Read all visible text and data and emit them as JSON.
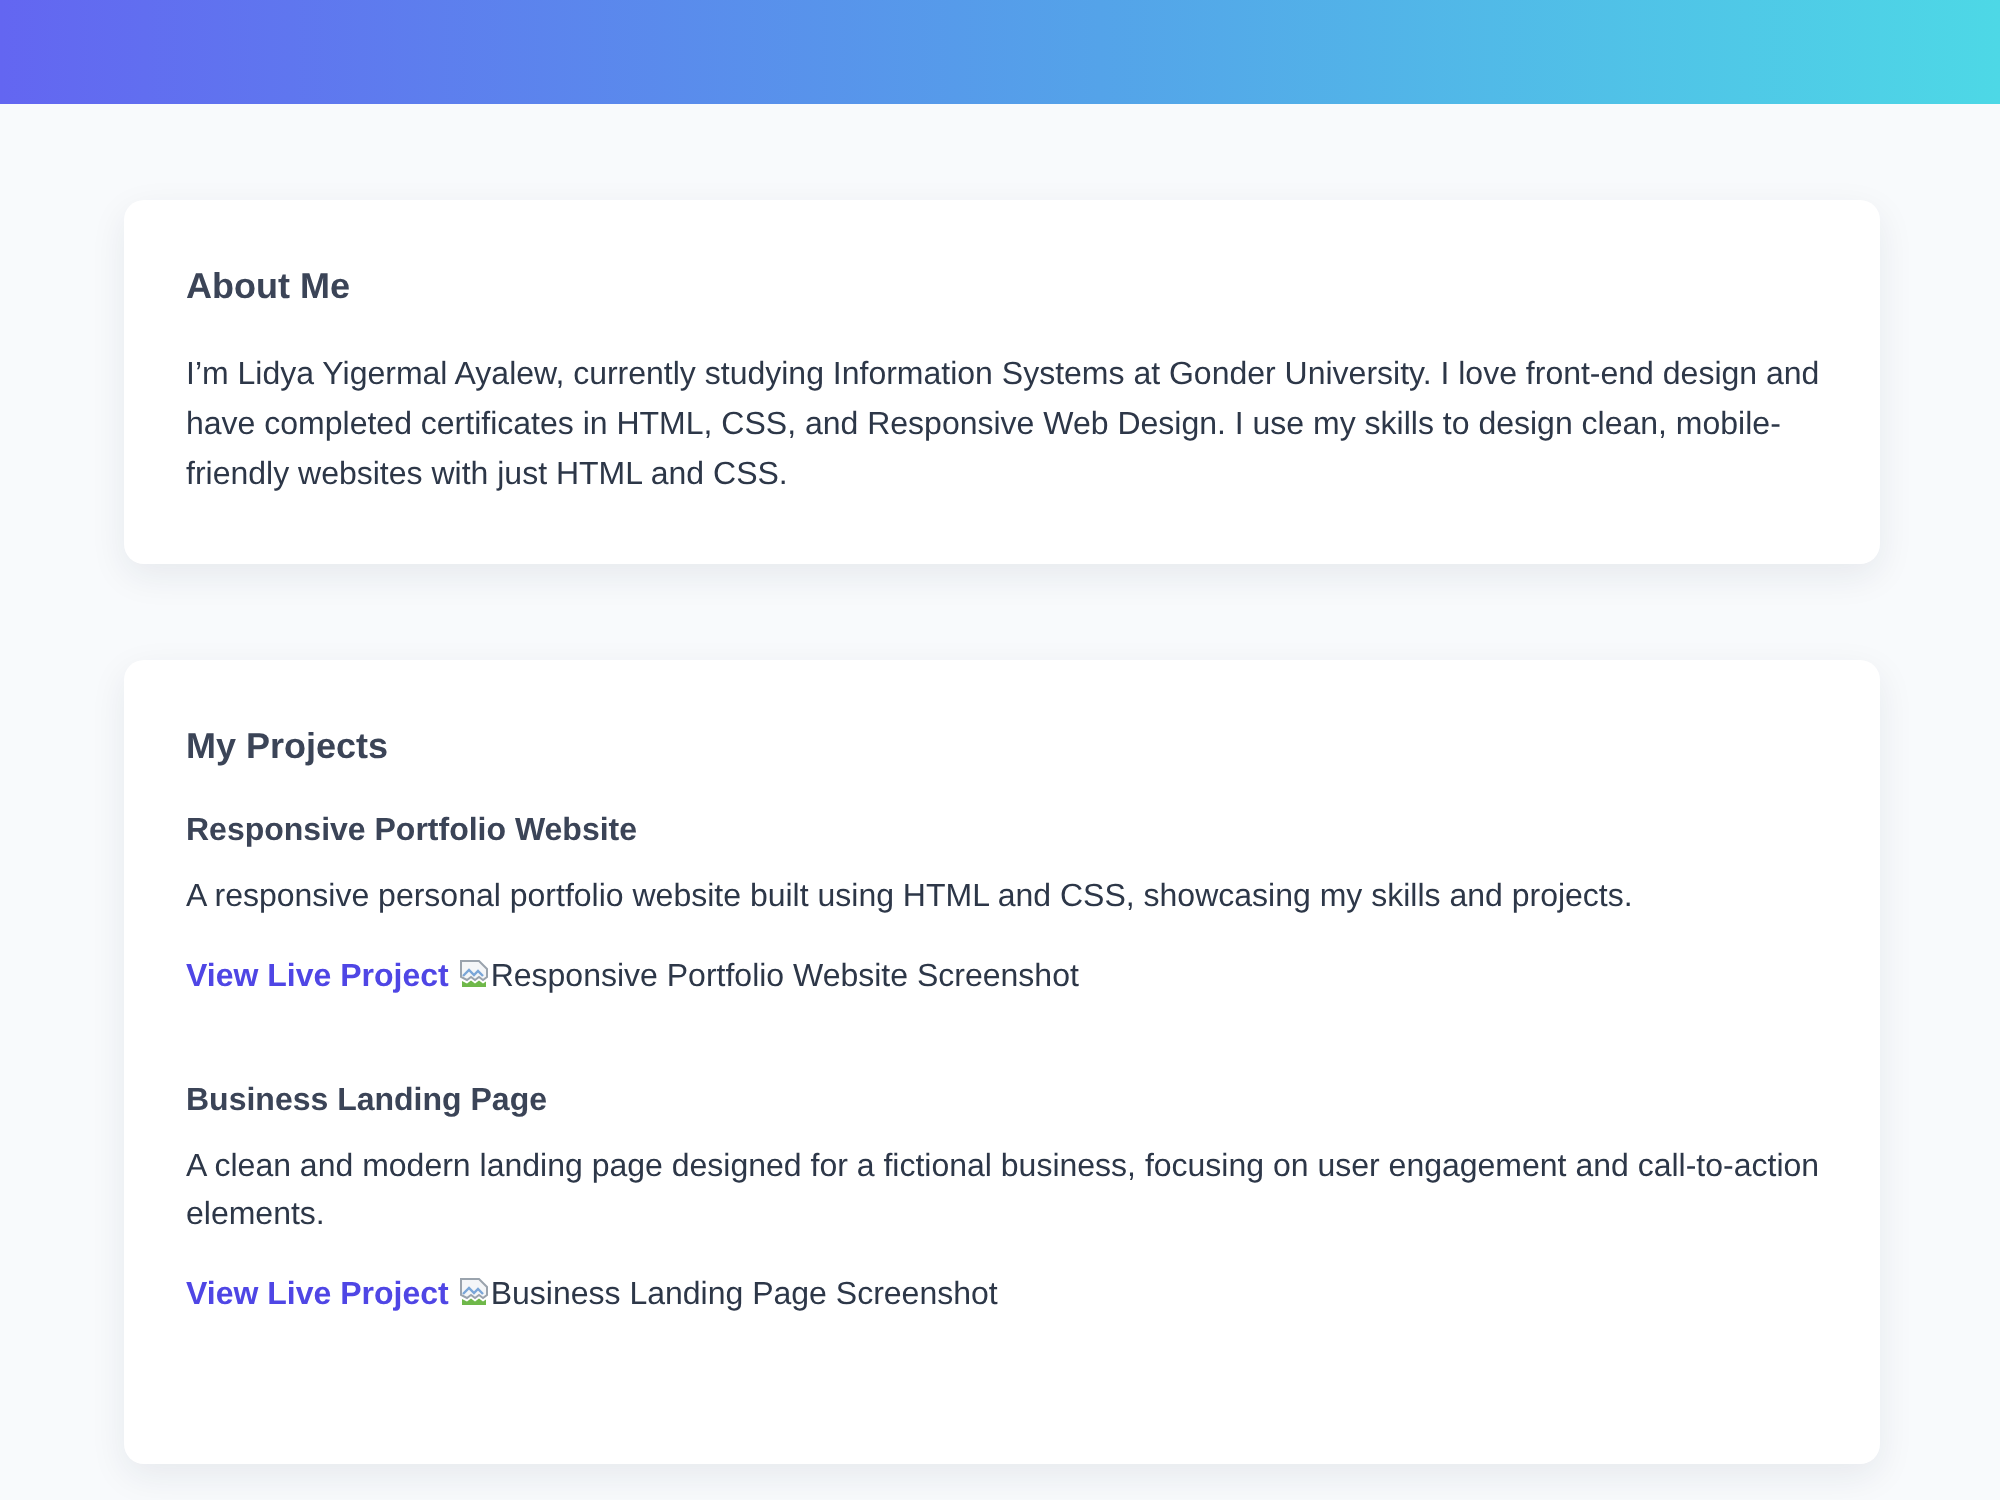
{
  "about": {
    "heading": "About Me",
    "text": "I’m Lidya Yigermal Ayalew, currently studying Information Systems at Gonder University. I love front-end design and have completed certificates in HTML, CSS, and Responsive Web Design. I use my skills to design clean, mobile-friendly websites with just HTML and CSS."
  },
  "projects": {
    "heading": "My Projects",
    "items": [
      {
        "title": "Responsive Portfolio Website",
        "description": "A responsive personal portfolio website built using HTML and CSS, showcasing my skills and projects.",
        "link": "View Live Project",
        "image_alt": "Responsive Portfolio Website Screenshot"
      },
      {
        "title": "Business Landing Page",
        "description": "A clean and modern landing page designed for a fictional business, focusing on user engagement and call-to-action elements.",
        "link": "View Live Project",
        "image_alt": "Business Landing Page Screenshot"
      }
    ]
  }
}
